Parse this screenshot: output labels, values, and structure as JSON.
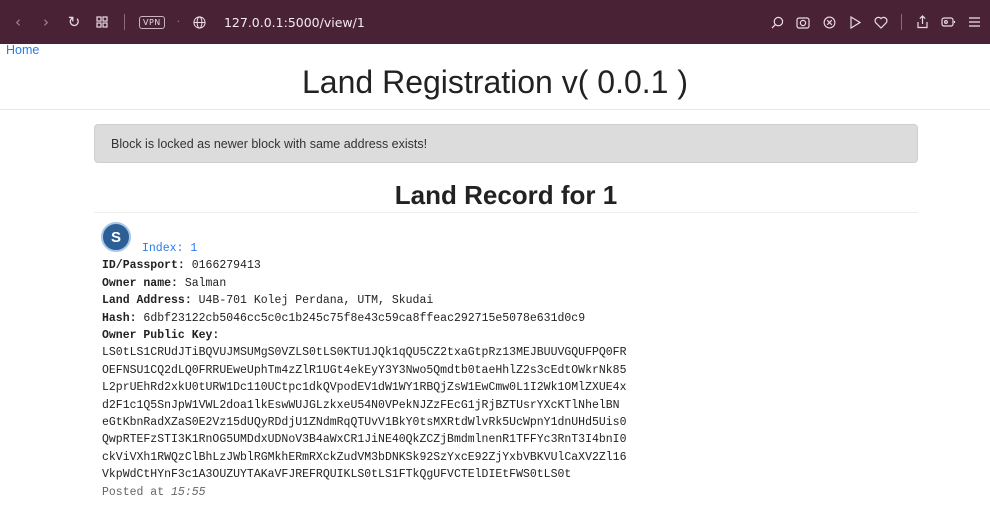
{
  "browser": {
    "vpn_label": "VPN",
    "url": "127.0.0.1:5000/view/1"
  },
  "nav": {
    "home": "Home"
  },
  "page": {
    "title": "Land Registration v( 0.0.1 )",
    "alert": "Block is locked as newer block with same address exists!",
    "record_title": "Land Record for 1"
  },
  "record": {
    "avatar_letter": "S",
    "index_label": "Index:",
    "index_value": "1",
    "id_label": "ID/Passport:",
    "id_value": "0166279413",
    "owner_label": "Owner name:",
    "owner_value": "Salman",
    "address_label": "Land Address:",
    "address_value": "U4B-701 Kolej Perdana, UTM, Skudai",
    "hash_label": "Hash:",
    "hash_value": "6dbf23122cb5046cc5c0c1b245c75f8e43c59ca8ffeac292715e5078e631d0c9",
    "pubkey_label": "Owner Public Key:",
    "pubkey_lines": [
      "LS0tLS1CRUdJTiBQVUJMSUMgS0VZLS0tLS0KTU1JQk1qQU5CZ2txaGtpRz13MEJBUUVGQUFPQ0FR",
      "OEFNSU1CQ2dLQ0FRRUEweUphTm4zZlR1UGt4ekEyY3Y3Nwo5Qmdtb0taeHhlZ2s3cEdtOWkrNk85",
      "L2prUEhRd2xkU0tURW1Dc110UCtpc1dkQVpodEV1dW1WY1RBQjZsW1EwCmw0L1I2Wk1OMlZXUE4x",
      "d2F1c1Q5SnJpW1VWL2doa1lkEswWUJGLzkxeU54N0VPekNJZzFEcG1jRjBZTUsrYXcKTlNhelBN",
      "eGtKbnRadXZaS0E2Vz15dUQyRDdjU1ZNdmRqQTUvV1BkY0tsMXRtdWlvRk5UcWpnY1dnUHd5Uis0",
      "QwpRTEFzSTI3K1RnOG5UMDdxUDNoV3B4aWxCR1JiNE40QkZCZjBmdmlnenR1TFFYc3RnT3I4bnI0",
      "ckViVXh1RWQzClBhLzJWblRGMkhERmRXckZudVM3bDNKSk92SzYxcE92ZjYxbVBKVUlCaXV2Zl16",
      "VkpWdCtHYnF3c1A3OUZUYTAKaVFJREFRQUIKLS0tLS1FTkQgUFVCTElDIEtFWS0tLS0t"
    ],
    "posted_prefix": "Posted at",
    "posted_time": "15:55"
  }
}
